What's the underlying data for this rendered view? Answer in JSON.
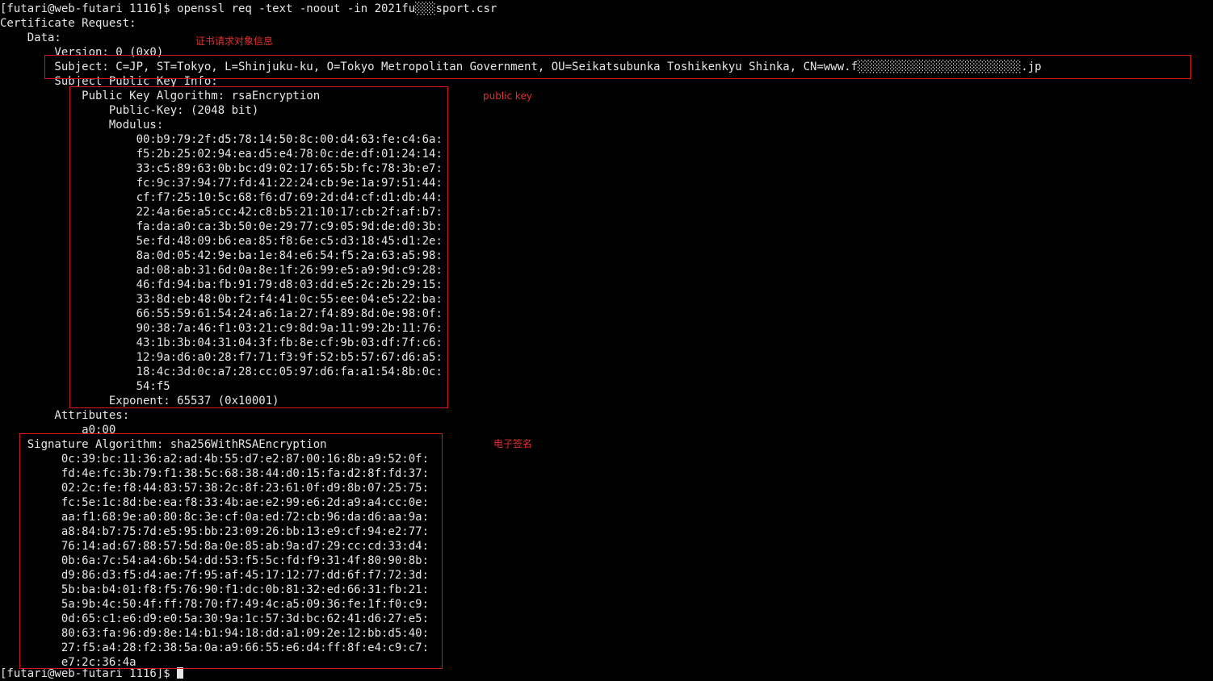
{
  "terminal": {
    "prompt_command": "[futari@web-futari 1116]$ openssl req -text -noout -in 2021fu░░░sport.csr",
    "cert_request_header": "Certificate Request:",
    "data_header": "    Data:",
    "version": "        Version: 0 (0x0)",
    "subject": "        Subject: C=JP, ST=Tokyo, L=Shinjuku-ku, O=Tokyo Metropolitan Government, OU=Seikatsubunka Toshikenkyu Shinka, CN=www.f░░░░░░░░░░░░░░░░░░░░░░░░.jp",
    "subject_pk_info": "        Subject Public Key Info:",
    "pk_algorithm": "            Public Key Algorithm: rsaEncryption",
    "public_key_bits": "                Public-Key: (2048 bit)",
    "modulus_label": "                Modulus:",
    "modulus_lines": [
      "                    00:b9:79:2f:d5:78:14:50:8c:00:d4:63:fe:c4:6a:",
      "                    f5:2b:25:02:94:ea:d5:e4:78:0c:de:df:01:24:14:",
      "                    33:c5:89:63:0b:bc:d9:02:17:65:5b:fc:78:3b:e7:",
      "                    fc:9c:37:94:77:fd:41:22:24:cb:9e:1a:97:51:44:",
      "                    cf:f7:25:10:5c:68:f6:d7:69:2d:d4:cf:d1:db:44:",
      "                    22:4a:6e:a5:cc:42:c8:b5:21:10:17:cb:2f:af:b7:",
      "                    fa:da:a0:ca:3b:50:0e:29:77:c9:05:9d:de:d0:3b:",
      "                    5e:fd:48:09:b6:ea:85:f8:6e:c5:d3:18:45:d1:2e:",
      "                    8a:0d:05:42:9e:ba:1e:84:e6:54:f5:2a:63:a5:98:",
      "                    ad:08:ab:31:6d:0a:8e:1f:26:99:e5:a9:9d:c9:28:",
      "                    46:fd:94:ba:fb:91:79:d8:03:dd:e5:2c:2b:29:15:",
      "                    33:8d:eb:48:0b:f2:f4:41:0c:55:ee:04:e5:22:ba:",
      "                    66:55:59:61:54:24:a6:1a:27:f4:89:8d:0e:98:0f:",
      "                    90:38:7a:46:f1:03:21:c9:8d:9a:11:99:2b:11:76:",
      "                    43:1b:3b:04:31:04:3f:fb:8e:cf:9b:03:df:7f:c6:",
      "                    12:9a:d6:a0:28:f7:71:f3:9f:52:b5:57:67:d6:a5:",
      "                    18:4c:3d:0c:a7:28:cc:05:97:d6:fa:a1:54:8b:0c:",
      "                    54:f5"
    ],
    "exponent": "                Exponent: 65537 (0x10001)",
    "attributes_label": "        Attributes:",
    "attributes_value": "            a0:00",
    "sig_algorithm": "    Signature Algorithm: sha256WithRSAEncryption",
    "signature_lines": [
      "         0c:39:bc:11:36:a2:ad:4b:55:d7:e2:87:00:16:8b:a9:52:0f:",
      "         fd:4e:fc:3b:79:f1:38:5c:68:38:44:d0:15:fa:d2:8f:fd:37:",
      "         02:2c:fe:f8:44:83:57:38:2c:8f:23:61:0f:d9:8b:07:25:75:",
      "         fc:5e:1c:8d:be:ea:f8:33:4b:ae:e2:99:e6:2d:a9:a4:cc:0e:",
      "         aa:f1:68:9e:a0:80:8c:3e:cf:0a:ed:72:cb:96:da:d6:aa:9a:",
      "         a8:84:b7:75:7d:e5:95:bb:23:09:26:bb:13:e9:cf:94:e2:77:",
      "         76:14:ad:67:88:57:5d:8a:0e:85:ab:9a:d7:29:cc:cd:33:d4:",
      "         0b:6a:7c:54:a4:6b:54:dd:53:f5:5c:fd:f9:31:4f:80:90:8b:",
      "         d9:86:d3:f5:d4:ae:7f:95:af:45:17:12:77:dd:6f:f7:72:3d:",
      "         5b:ba:b4:01:f8:f5:76:90:f1:dc:0b:81:32:ed:66:31:fb:21:",
      "         5a:9b:4c:50:4f:ff:78:70:f7:49:4c:a5:09:36:fe:1f:f0:c9:",
      "         0d:65:c1:e6:d9:e0:5a:30:9a:1c:57:3d:bc:62:41:d6:27:e5:",
      "         80:63:fa:96:d9:8e:14:b1:94:18:dd:a1:09:2e:12:bb:d5:40:",
      "         27:f5:a4:28:f2:38:5a:0a:a9:66:55:e6:d4:ff:8f:e4:c9:c7:",
      "         e7:2c:36:4a"
    ],
    "final_prompt": "[futari@web-futari 1116]$ "
  },
  "annotations": {
    "subject_label": "证书请求对象信息",
    "public_key_label": "public key",
    "signature_label": "电子签名",
    "color": "#d01b1b"
  },
  "colors": {
    "background": "#000000",
    "text": "#e6e6e6",
    "annotation": "#e03030"
  }
}
